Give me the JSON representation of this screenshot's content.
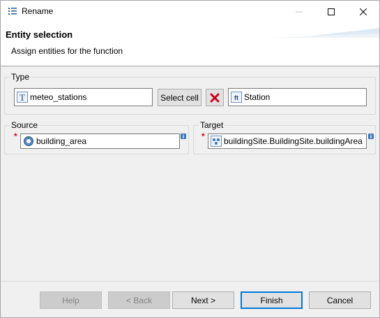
{
  "window": {
    "title": "Rename"
  },
  "header": {
    "title": "Entity selection",
    "description": "Assign entities for the function"
  },
  "type_group": {
    "label": "Type",
    "source_type_value": "meteo_stations",
    "source_type_icon": "type-icon",
    "select_cell_label": "Select cell",
    "target_type_value": "Station",
    "target_type_icon": "feature-type-icon"
  },
  "source_group": {
    "label": "Source",
    "value": "building_area",
    "required_marker": "*"
  },
  "target_group": {
    "label": "Target",
    "value": "buildingSite.BuildingSite.buildingArea",
    "required_marker": "*"
  },
  "buttons": {
    "help": "Help",
    "back": "< Back",
    "next": "Next >",
    "finish": "Finish",
    "cancel": "Cancel"
  },
  "colors": {
    "accent": "#0078d7",
    "remove_icon": "#d0021b"
  }
}
